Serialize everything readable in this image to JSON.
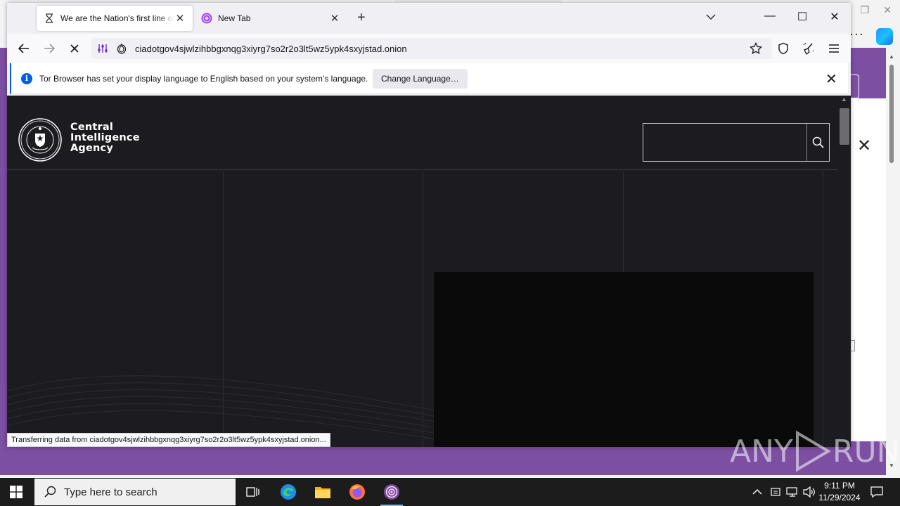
{
  "browser": {
    "tabs": [
      {
        "title": "We are the Nation's first line of defense",
        "active": true
      },
      {
        "title": "New Tab",
        "active": false
      }
    ],
    "url": "ciadotgov4sjwlzihbbgxnqg3xiyrg7so2r2o3lt5wz5ypk4sxyjstad.onion",
    "notification": {
      "text": "Tor Browser has set your display language to English based on your system’s language.",
      "button": "Change Language…"
    },
    "status_text": "Transferring data from ciadotgov4sjwlzihbbgxnqg3xiyrg7so2r2o3lt5wz5ypk4sxyjstad.onion..."
  },
  "page": {
    "brand": {
      "line1": "Central",
      "line2": "Intelligence",
      "line3": "Agency"
    },
    "search_placeholder": ""
  },
  "taskbar": {
    "search_placeholder": "Type here to search",
    "time": "9:11 PM",
    "date": "11/29/2024"
  },
  "watermark": {
    "left": "ANY",
    "right": "RUN"
  },
  "colors": {
    "tor_purple": "#7c4fa3",
    "page_bg": "#1b1b20",
    "accent_blue": "#0060df"
  }
}
